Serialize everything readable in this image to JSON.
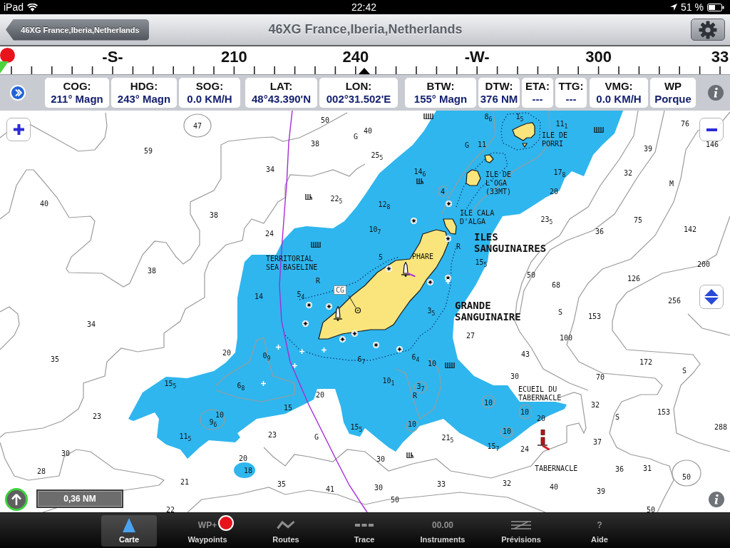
{
  "status_bar": {
    "device": "iPad",
    "time": "22:42",
    "battery": "51 %"
  },
  "nav_bar": {
    "back_button": "46XG France,Iberia,Netherlands",
    "title": "46XG France,Iberia,Netherlands"
  },
  "compass": {
    "labels": [
      "-S-",
      "210",
      "240",
      "-W-",
      "300",
      "33"
    ]
  },
  "instruments": [
    {
      "label": "COG:",
      "value": "211° Magn"
    },
    {
      "label": "HDG:",
      "value": "243° Magn"
    },
    {
      "label": "SOG:",
      "value": "0.0 KM/H"
    },
    {
      "label": "LAT:",
      "value": "48°43.390'N"
    },
    {
      "label": "LON:",
      "value": "002°31.502'E"
    },
    {
      "label": "BTW:",
      "value": "155° Magn"
    },
    {
      "label": "DTW:",
      "value": "376 NM"
    },
    {
      "label": "ETA:",
      "value": "---"
    },
    {
      "label": "TTG:",
      "value": "---"
    },
    {
      "label": "VMG:",
      "value": "0.0 KM/H"
    },
    {
      "label": "WP",
      "value": "Porque"
    }
  ],
  "map": {
    "place_names": [
      {
        "text": "ILE DE\nPORRI",
        "kind": "minor"
      },
      {
        "text": "ILE DE\nL'OGA\n(33MT)",
        "kind": "minor"
      },
      {
        "text": "ILE CALA\nD'ALGA",
        "kind": "minor"
      },
      {
        "text": "ILES\nSANGUINAIRES",
        "kind": "major"
      },
      {
        "text": "TERRITORIAL\nSEA BASELINE",
        "kind": "minor"
      },
      {
        "text": "PHARE",
        "kind": "minor"
      },
      {
        "text": "GRANDE\nSANGUINAIRE",
        "kind": "major"
      },
      {
        "text": "ECUEIL DU\nTABERNACLE",
        "kind": "minor"
      },
      {
        "text": "TABERNACLE",
        "kind": "minor"
      }
    ],
    "soundings": [
      "50",
      "8$_{6}$",
      "1$_{5}$",
      "47",
      "11$_{1}$",
      "76",
      "40",
      "G",
      "38",
      "G",
      "11",
      "146",
      "59",
      "39",
      "25$_{5}$",
      "34",
      "14$_{6}$",
      "17$_{8}$",
      "32",
      "M",
      "4",
      "20",
      "22$_{5}$",
      "40",
      "12$_{8}$",
      "38",
      "23$_{5}$",
      "75",
      "24",
      "10$_{7}$",
      "36",
      "142",
      "R",
      "5",
      "15$_{5}$",
      "200",
      "38",
      "50",
      "R",
      "126",
      "68",
      "14",
      "5$_{4}$",
      "256",
      "3$_{5}$",
      "S",
      "153",
      "34",
      "27",
      "100",
      "35",
      "20",
      "0$_{9}$",
      "6$_{7}$",
      "6$_{4}$",
      "43",
      "10",
      "172",
      "S",
      "30",
      "70",
      "15$_{5}$",
      "6$_{8}$",
      "10$_{1}$",
      "3$_{7}$",
      "20",
      "R",
      "10",
      "32",
      "15",
      "10",
      "153",
      "23",
      "10",
      "20",
      "S",
      "9$_{6}$",
      "15$_{5}$",
      "10",
      "288",
      "10",
      "11$_{5}$",
      "23",
      "G",
      "21$_{5}$",
      "37",
      "15$_{7}$",
      "24",
      "30",
      "20",
      "30",
      "28",
      "18",
      "36",
      "31",
      "50",
      "21",
      "35",
      "33",
      "32",
      "41",
      "30",
      "40",
      "39",
      "50",
      "22",
      "50"
    ],
    "tag": "CG",
    "scale": "0,36 NM"
  },
  "tab_bar": {
    "tabs": [
      {
        "label": "Carte",
        "kind": "chart",
        "selected": true,
        "badge": false
      },
      {
        "label": "Waypoints",
        "kind": "text",
        "icon_text": "WP+",
        "selected": false,
        "badge": true
      },
      {
        "label": "Routes",
        "kind": "routes",
        "selected": false,
        "badge": false
      },
      {
        "label": "Trace",
        "kind": "trace",
        "selected": false,
        "badge": false
      },
      {
        "label": "Instruments",
        "kind": "text",
        "icon_text": "00.00",
        "selected": false,
        "badge": false
      },
      {
        "label": "Prévisions",
        "kind": "forecast",
        "selected": false,
        "badge": false
      },
      {
        "label": "Aide",
        "kind": "text",
        "icon_text": "?",
        "selected": false,
        "badge": false
      }
    ]
  }
}
